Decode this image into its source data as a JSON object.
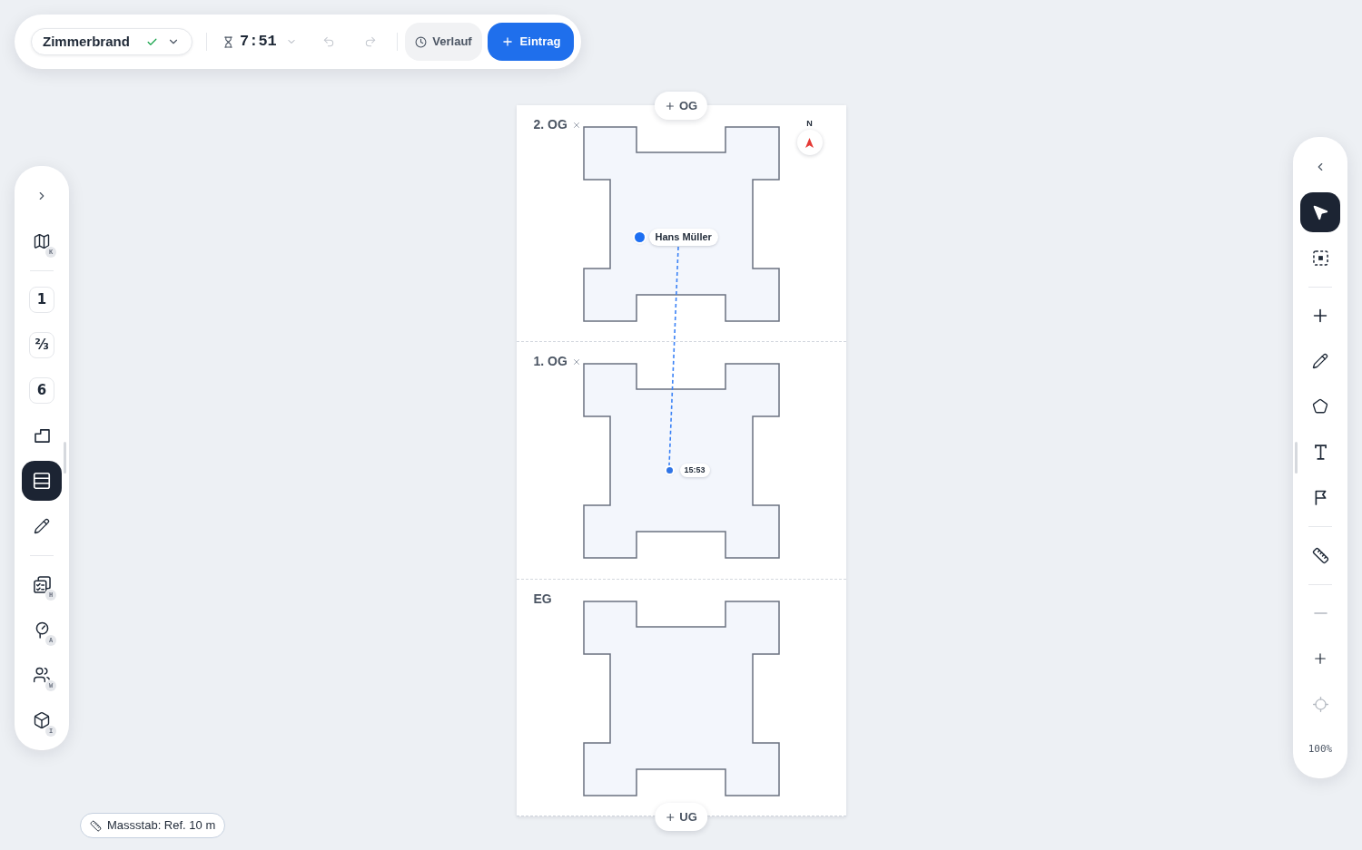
{
  "toolbar": {
    "incident": {
      "title": "Zimmerbrand",
      "confirmed": true
    },
    "timer": {
      "value": "7:51"
    },
    "undo": {
      "disabled": true
    },
    "redo": {
      "disabled": true
    },
    "history_button": {
      "label": "Verlauf"
    },
    "add_button": {
      "label": "Eintrag"
    }
  },
  "left_toolbar": {
    "map_view": {
      "shortcut": "K",
      "selected": false
    },
    "floor_modes": [
      {
        "label": "1",
        "selected": false
      },
      {
        "label": "⅔",
        "selected": false
      },
      {
        "label": "6",
        "selected": false
      }
    ],
    "tools": [
      {
        "selected": false
      },
      {
        "selected": true
      },
      {
        "selected": false
      }
    ],
    "panels": [
      {
        "shortcut": "H"
      },
      {
        "shortcut": "A"
      },
      {
        "shortcut": "W"
      },
      {
        "shortcut": "I"
      }
    ]
  },
  "right_toolbar": {
    "tool_groups": [
      {
        "tools": [
          {
            "selected": true
          },
          {
            "selected": false
          }
        ]
      },
      {
        "tools": [
          {
            "selected": false
          },
          {
            "selected": false
          },
          {
            "selected": false
          },
          {
            "selected": false
          },
          {
            "selected": false
          }
        ]
      },
      {
        "tools": [
          {
            "selected": false
          }
        ]
      }
    ],
    "zoom_out": {
      "disabled": true
    },
    "zoom_in": {
      "disabled": false
    },
    "recenter": {
      "disabled": true
    },
    "zoom_level": "100%"
  },
  "canvas": {
    "add_floor_above": {
      "label": "OG"
    },
    "floors": [
      {
        "label": "2. OG",
        "removable": true
      },
      {
        "label": "1. OG",
        "removable": true
      },
      {
        "label": "EG",
        "removable": false
      }
    ],
    "compass": {
      "label": "N"
    },
    "person": {
      "name": "Hans Müller"
    },
    "track_end": {
      "time": "15:53"
    },
    "add_floor_below": {
      "label": "UG"
    }
  },
  "scale": {
    "label": "Massstab: Ref. 10 m"
  }
}
